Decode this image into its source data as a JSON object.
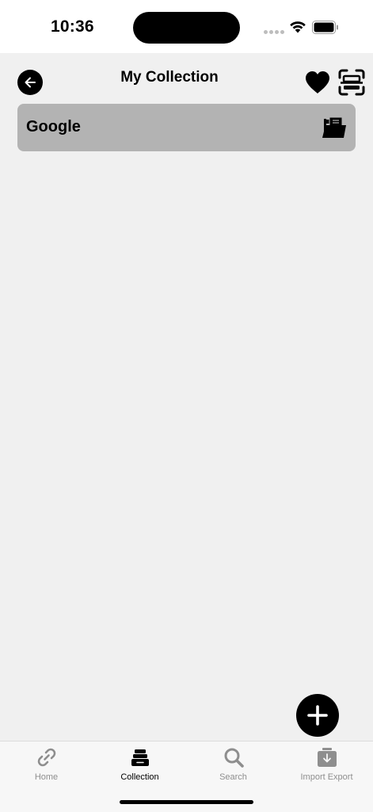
{
  "status_bar": {
    "time": "10:36"
  },
  "header": {
    "title": "My Collection"
  },
  "collections": [
    {
      "label": "Google"
    }
  ],
  "tabs": [
    {
      "label": "Home",
      "icon": "link-icon",
      "active": false
    },
    {
      "label": "Collection",
      "icon": "archive-icon",
      "active": true
    },
    {
      "label": "Search",
      "icon": "magnifier-icon",
      "active": false
    },
    {
      "label": "Import Export",
      "icon": "tray-download-icon",
      "active": false
    }
  ],
  "colors": {
    "background": "#f0f0f0",
    "item_background": "#b3b3b3",
    "accent": "#000000",
    "tab_inactive": "#8e8e8e"
  }
}
